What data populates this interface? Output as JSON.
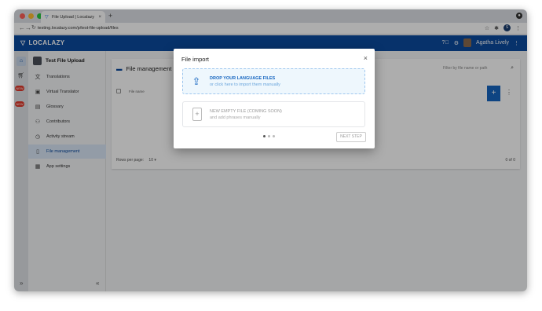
{
  "browser": {
    "tab_title": "File Upload | Localazy",
    "tab_close": "×",
    "new_tab": "+",
    "url": "testing.localazy.com/p/test-file-upload/files",
    "profile_initial": "S"
  },
  "app": {
    "logo": "LOCALAZY",
    "user_name": "Agatha Lively"
  },
  "rail": {
    "badge_1": "NEW",
    "badge_2": "NEW"
  },
  "sidebar": {
    "project": "Test File Upload",
    "items": [
      {
        "label": "Translations",
        "icon": "translate-icon"
      },
      {
        "label": "Virtual Translator",
        "icon": "robot-icon"
      },
      {
        "label": "Glossary",
        "icon": "book-icon"
      },
      {
        "label": "Contributors",
        "icon": "people-icon"
      },
      {
        "label": "Activity stream",
        "icon": "clock-icon"
      },
      {
        "label": "File management",
        "icon": "file-icon"
      },
      {
        "label": "App settings",
        "icon": "grid-icon"
      }
    ],
    "expand": "»",
    "collapse": "«"
  },
  "main": {
    "title": "File management",
    "search_placeholder": "Filter by file name or path",
    "col_file_name": "File name",
    "rows_per_page_label": "Rows per page:",
    "rows_per_page_value": "10",
    "range": "0 of 0",
    "fab": "+"
  },
  "modal": {
    "title": "File import",
    "close": "×",
    "option1_title": "DROP YOUR LANGUAGE FILES",
    "option1_sub": "or click here to import them manually",
    "option2_title": "NEW EMPTY FILE (COMING SOON)",
    "option2_sub": "and add phrases manually",
    "next_step": "NEXT STEP",
    "steps": 3,
    "current_step": 1
  },
  "colors": {
    "brand": "#0b4a9e",
    "accent": "#1565c0",
    "badge": "#e0392b"
  }
}
